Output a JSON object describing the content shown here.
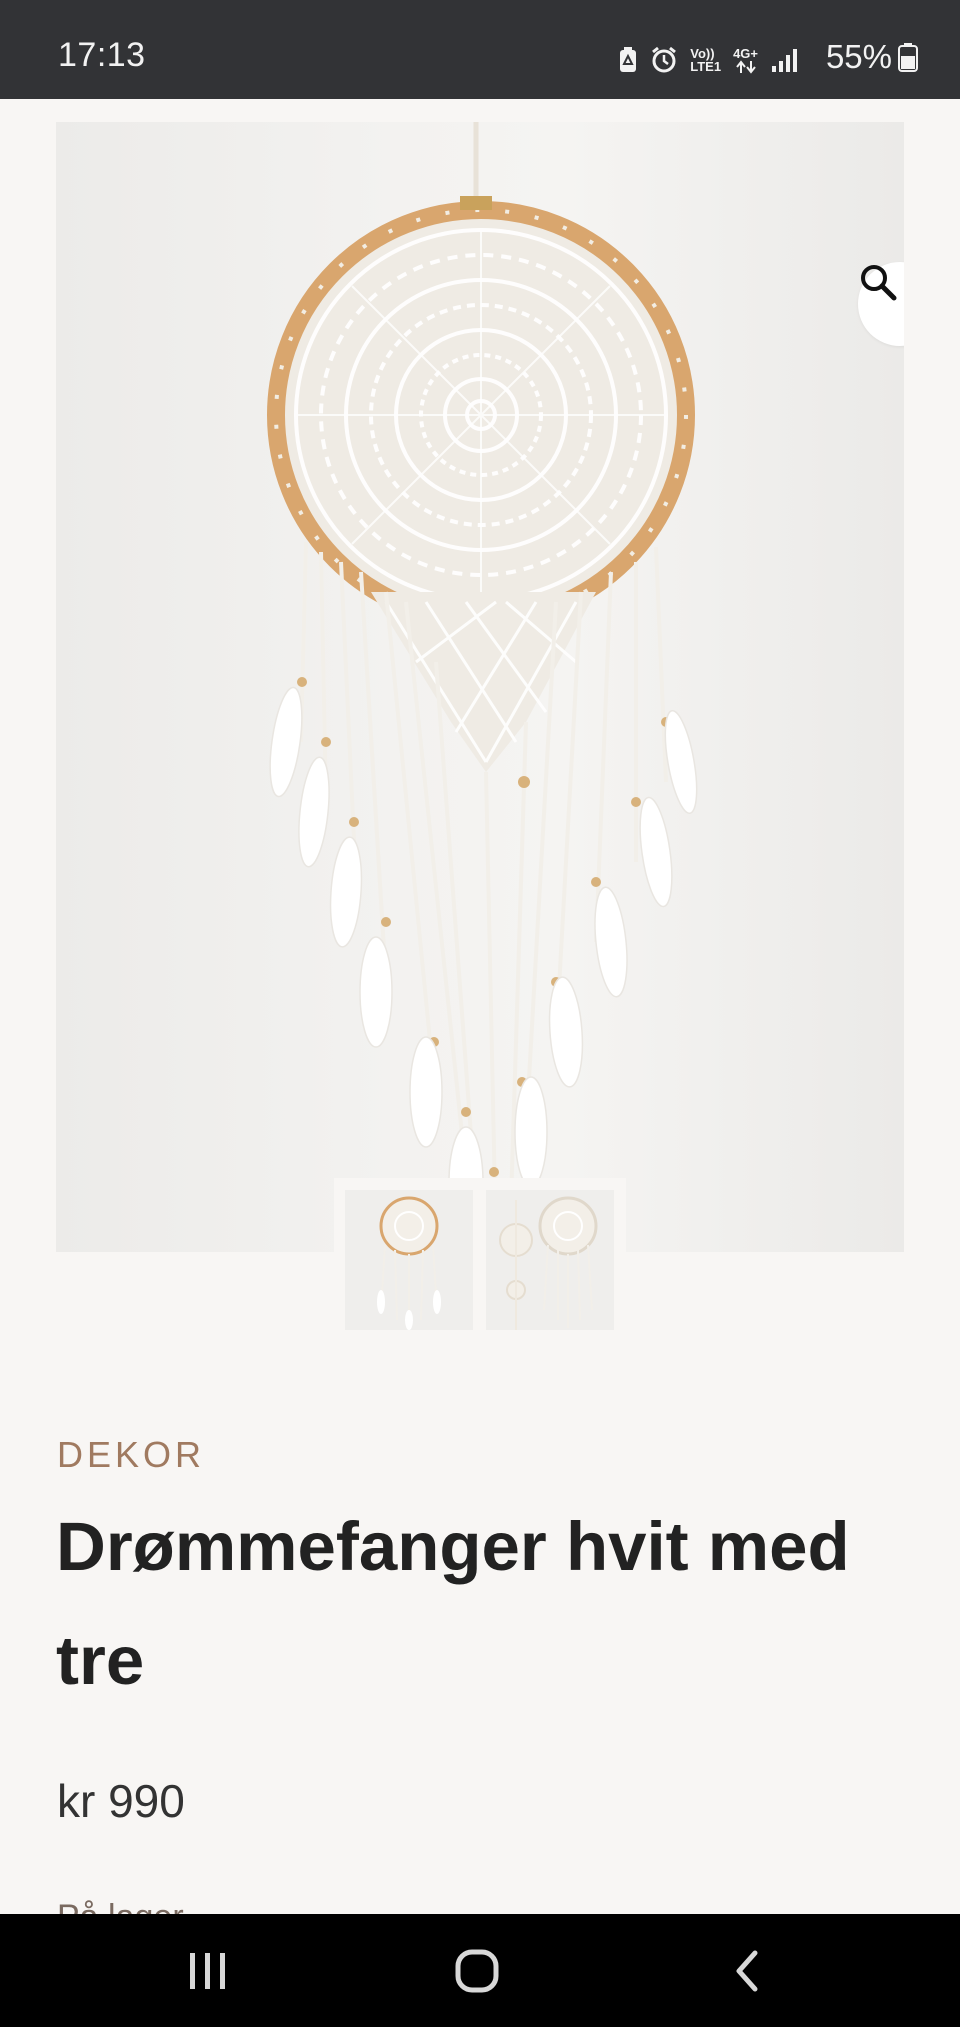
{
  "status_bar": {
    "time": "17:13",
    "network_top": "Vo))",
    "network_bottom": "LTE1",
    "data_label": "4G+",
    "battery": "55%"
  },
  "product": {
    "zoom_icon": "search-icon",
    "category": "DEKOR",
    "title": "Drømmefanger hvit med tre",
    "price": "kr 990",
    "stock": "På lager"
  },
  "thumbnails": [
    {
      "name": "thumbnail-1"
    },
    {
      "name": "thumbnail-2"
    }
  ],
  "nav_bar": {
    "recents_icon": "recents-icon",
    "home_icon": "home-icon",
    "back_icon": "back-icon"
  },
  "colors": {
    "background": "#f8f6f4",
    "status_bar": "#323336",
    "category": "#a07a60",
    "title": "#222222",
    "hoop": "#d9a66e"
  }
}
